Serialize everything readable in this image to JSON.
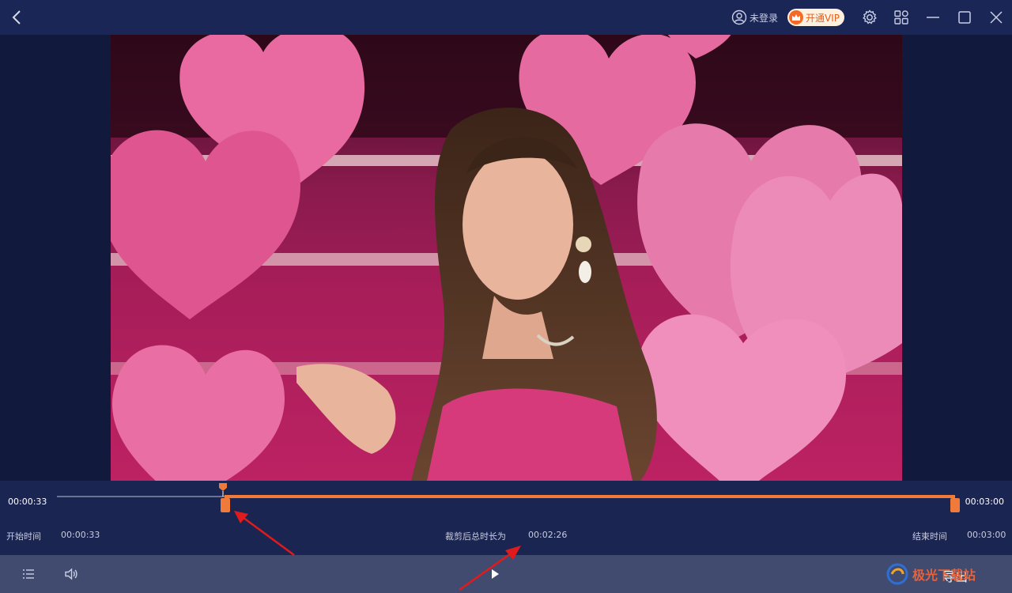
{
  "titlebar": {
    "login_label": "未登录",
    "vip_label": "开通VIP"
  },
  "timeline": {
    "current_time": "00:00:33",
    "end_time": "00:03:00",
    "start_label": "开始时间",
    "start_value": "00:00:33",
    "duration_label": "裁剪后总时长为",
    "duration_value": "00:02:26",
    "end_label": "结束时间",
    "end_value": "00:03:00",
    "selection_start_fraction": 0.183,
    "selection_end_fraction": 1.0
  },
  "bottombar": {
    "export_label": "导出"
  },
  "watermark": {
    "text": "极光下载站"
  },
  "colors": {
    "accent": "#f07a3a",
    "titlebar_bg": "#1a2655",
    "timeline_bg": "#1b2552",
    "bottombar_bg": "#414b70",
    "vip_bg": "#fff1e0"
  },
  "icons": [
    "back-icon",
    "user-icon",
    "crown-icon",
    "gear-icon",
    "grid-icon",
    "minimize-icon",
    "maximize-icon",
    "close-icon",
    "list-icon",
    "volume-icon",
    "play-icon"
  ]
}
